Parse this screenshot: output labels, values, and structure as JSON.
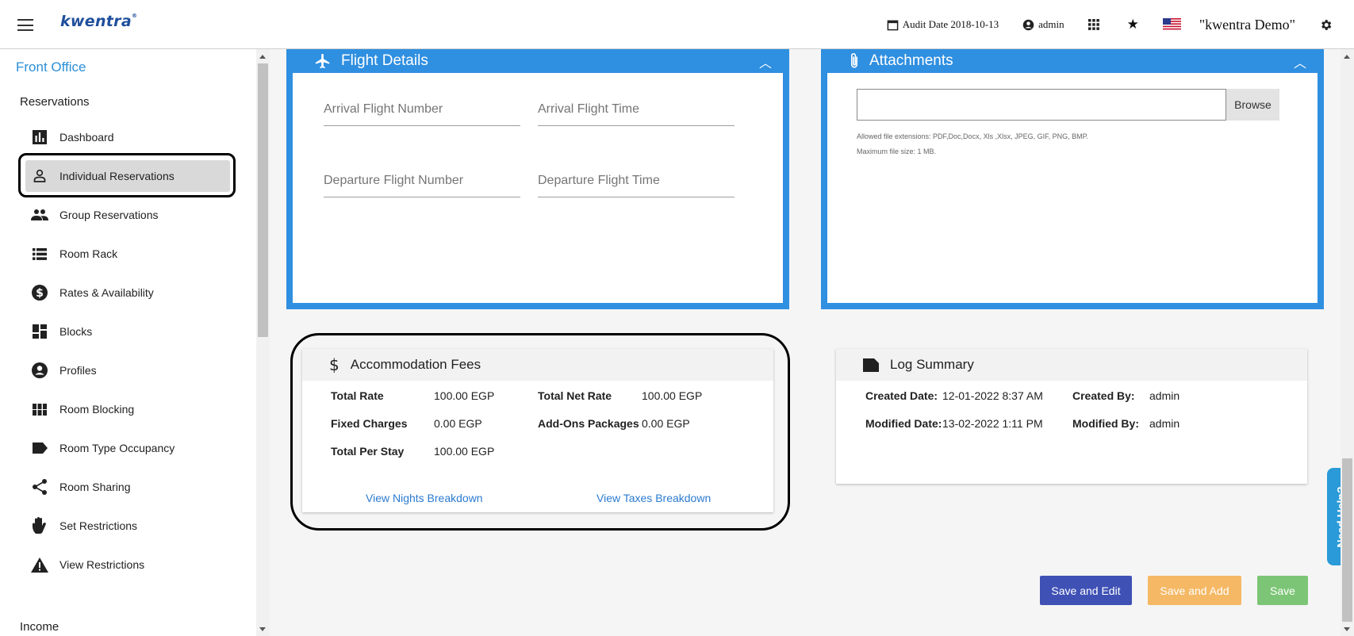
{
  "header": {
    "logo": "kwentra",
    "logo_mark": "®",
    "audit_date": "Audit Date 2018-10-13",
    "user": "admin",
    "property": "\"kwentra Demo\""
  },
  "sidebar": {
    "module": "Front Office",
    "section": "Reservations",
    "items": [
      {
        "label": "Dashboard",
        "icon": "bar-chart-icon"
      },
      {
        "label": "Individual Reservations",
        "icon": "person-icon"
      },
      {
        "label": "Group Reservations",
        "icon": "group-icon"
      },
      {
        "label": "Room Rack",
        "icon": "list-icon"
      },
      {
        "label": "Rates & Availability",
        "icon": "dollar-circle-icon"
      },
      {
        "label": "Blocks",
        "icon": "dashboard-icon"
      },
      {
        "label": "Profiles",
        "icon": "account-circle-icon"
      },
      {
        "label": "Room Blocking",
        "icon": "grid-icon"
      },
      {
        "label": "Room Type Occupancy",
        "icon": "label-icon"
      },
      {
        "label": "Room Sharing",
        "icon": "share-icon"
      },
      {
        "label": "Set Restrictions",
        "icon": "hand-icon"
      },
      {
        "label": "View Restrictions",
        "icon": "warning-icon"
      }
    ],
    "next_section": "Income"
  },
  "flight": {
    "title": "Flight Details",
    "arrival_number": "Arrival Flight Number",
    "arrival_time": "Arrival Flight Time",
    "departure_number": "Departure Flight Number",
    "departure_time": "Departure Flight Time"
  },
  "attachments": {
    "title": "Attachments",
    "browse": "Browse",
    "allowed": "Allowed file extensions: PDF,Doc,Docx, Xls ,Xlsx, JPEG, GIF, PNG, BMP.",
    "max_size": "Maximum file size: 1 MB."
  },
  "accommodation": {
    "title": "Accommodation Fees",
    "total_rate_label": "Total Rate",
    "total_rate": "100.00 EGP",
    "total_net_rate_label": "Total Net Rate",
    "total_net_rate": "100.00 EGP",
    "fixed_charges_label": "Fixed Charges",
    "fixed_charges": "0.00 EGP",
    "addons_label": "Add-Ons Packages",
    "addons": "0.00 EGP",
    "per_stay_label": "Total Per Stay",
    "per_stay": "100.00 EGP",
    "nights_link": "View Nights Breakdown",
    "taxes_link": "View Taxes Breakdown"
  },
  "log": {
    "title": "Log Summary",
    "created_date_label": "Created Date:",
    "created_date": "12-01-2022 8:37 AM",
    "created_by_label": "Created By:",
    "created_by": "admin",
    "modified_date_label": "Modified Date:",
    "modified_date": "13-02-2022 1:11 PM",
    "modified_by_label": "Modified By:",
    "modified_by": "admin"
  },
  "actions": {
    "save_edit": "Save and Edit",
    "save_add": "Save and Add",
    "save": "Save"
  },
  "help": "Need Help?",
  "colors": {
    "primary_blue": "#2f8fe0",
    "save_edit": "#3f51b5",
    "save_add": "#f5b865",
    "save": "#7cc576",
    "link": "#2b7bd0"
  }
}
